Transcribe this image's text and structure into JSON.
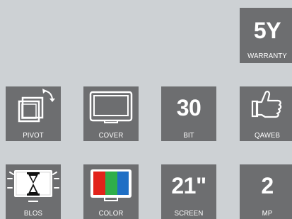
{
  "tiles": {
    "warranty": {
      "value": "5Y",
      "label": "WARRANTY",
      "icon": "warranty-badge"
    },
    "pivot": {
      "label": "PIVOT",
      "icon": "pivot-rotate-icon"
    },
    "cover": {
      "label": "COVER",
      "icon": "monitor-cover-icon"
    },
    "bit": {
      "value": "30",
      "label": "BIT",
      "icon": "bit-depth-badge"
    },
    "qaweb": {
      "label": "QAWEB",
      "icon": "thumbs-up-icon"
    },
    "blos": {
      "label": "BLOS",
      "icon": "hourglass-monitor-icon"
    },
    "color": {
      "label": "COLOR",
      "icon": "rgb-monitor-icon"
    },
    "screen": {
      "value": "21\"",
      "label": "SCREEN",
      "icon": "screen-size-badge"
    },
    "mp": {
      "value": "2",
      "label": "MP",
      "icon": "megapixel-badge"
    }
  },
  "colors": {
    "background": "#cdd1d4",
    "tile": "#6d6e70",
    "foreground": "#ffffff",
    "rgb_red": "#e2231a",
    "rgb_green": "#2fae4a",
    "rgb_blue": "#1f6fc5"
  }
}
